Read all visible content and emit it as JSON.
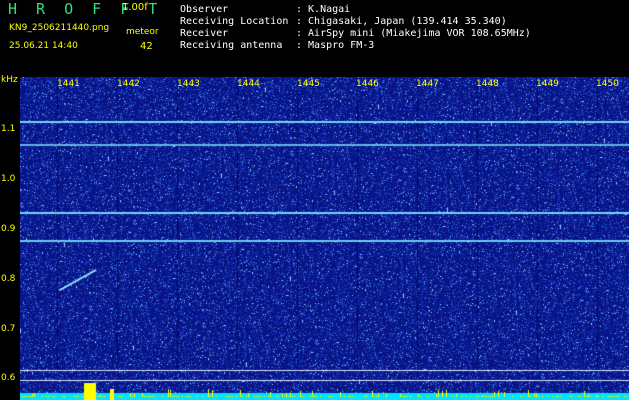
{
  "header": {
    "brand": "H R O F F T",
    "version": "1.00f",
    "filename": "KN9_2506211440.png",
    "meteor_label": "meteor",
    "datetime": "25.06.21 14:40",
    "meteor_count": "42"
  },
  "info": {
    "observer_label": "Observer",
    "observer_value": ": K.Nagai",
    "location_label": "Receiving Location",
    "location_value": ": Chigasaki, Japan (139.414 35.340)",
    "receiver_label": "Receiver",
    "receiver_value": ": AirSpy mini (Miakejima VOR 108.65MHz)",
    "antenna_label": "Receiving antenna",
    "antenna_value": ": Maspro FM-3"
  },
  "axis": {
    "y_unit": "kHz",
    "y_ticks": [
      "1.1",
      "1.0",
      "0.9",
      "0.8",
      "0.7",
      "0.6"
    ],
    "x_ticks": [
      "1441",
      "1442",
      "1443",
      "1444",
      "1445",
      "1446",
      "1447",
      "1448",
      "1449",
      "1450"
    ]
  },
  "colors": {
    "background": "#000000",
    "label_yellow": "#ffff00",
    "brand_green": "#2fe07a",
    "spectrogram_base": "#0a1a8a",
    "signal_cyan": "#7fe8ff",
    "baseline_cyan": "#00e5ff"
  }
}
